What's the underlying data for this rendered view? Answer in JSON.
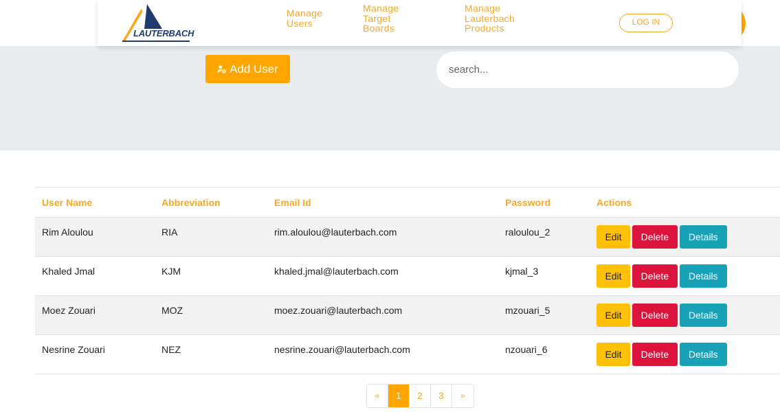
{
  "brand": {
    "name": "LAUTERBACH"
  },
  "nav": {
    "manage_users": "Manage Users",
    "manage_target_boards": "Manage Target Boards",
    "manage_products": "Manage Lauterbach Products",
    "login": "LOG IN"
  },
  "toolbar": {
    "add_user": "Add User",
    "search_placeholder": "search..."
  },
  "table": {
    "headers": [
      "User Name",
      "Abbreviation",
      "Email Id",
      "Password",
      "Actions"
    ],
    "rows": [
      {
        "name": "Rim Aloulou",
        "abbr": "RIA",
        "email": "rim.aloulou@lauterbach.com",
        "password": "raloulou_2"
      },
      {
        "name": "Khaled Jmal",
        "abbr": "KJM",
        "email": "khaled.jmal@lauterbach.com",
        "password": "kjmal_3"
      },
      {
        "name": "Moez Zouari",
        "abbr": "MOZ",
        "email": "moez.zouari@lauterbach.com",
        "password": "mzouari_5"
      },
      {
        "name": "Nesrine Zouari",
        "abbr": "NEZ",
        "email": "nesrine.zouari@lauterbach.com",
        "password": "nzouari_6"
      }
    ],
    "actions": {
      "edit": "Edit",
      "delete": "Delete",
      "details": "Details"
    }
  },
  "pagination": {
    "prev": "«",
    "pages": [
      "1",
      "2",
      "3"
    ],
    "next": "»",
    "active": "1"
  },
  "colors": {
    "accent": "#ffa500",
    "nav_text": "#f7a823",
    "brand_blue": "#1e3a6e",
    "edit": "#ffc107",
    "delete": "#dc143c",
    "details": "#17a2b8",
    "hero_bg": "#e9ecef"
  }
}
